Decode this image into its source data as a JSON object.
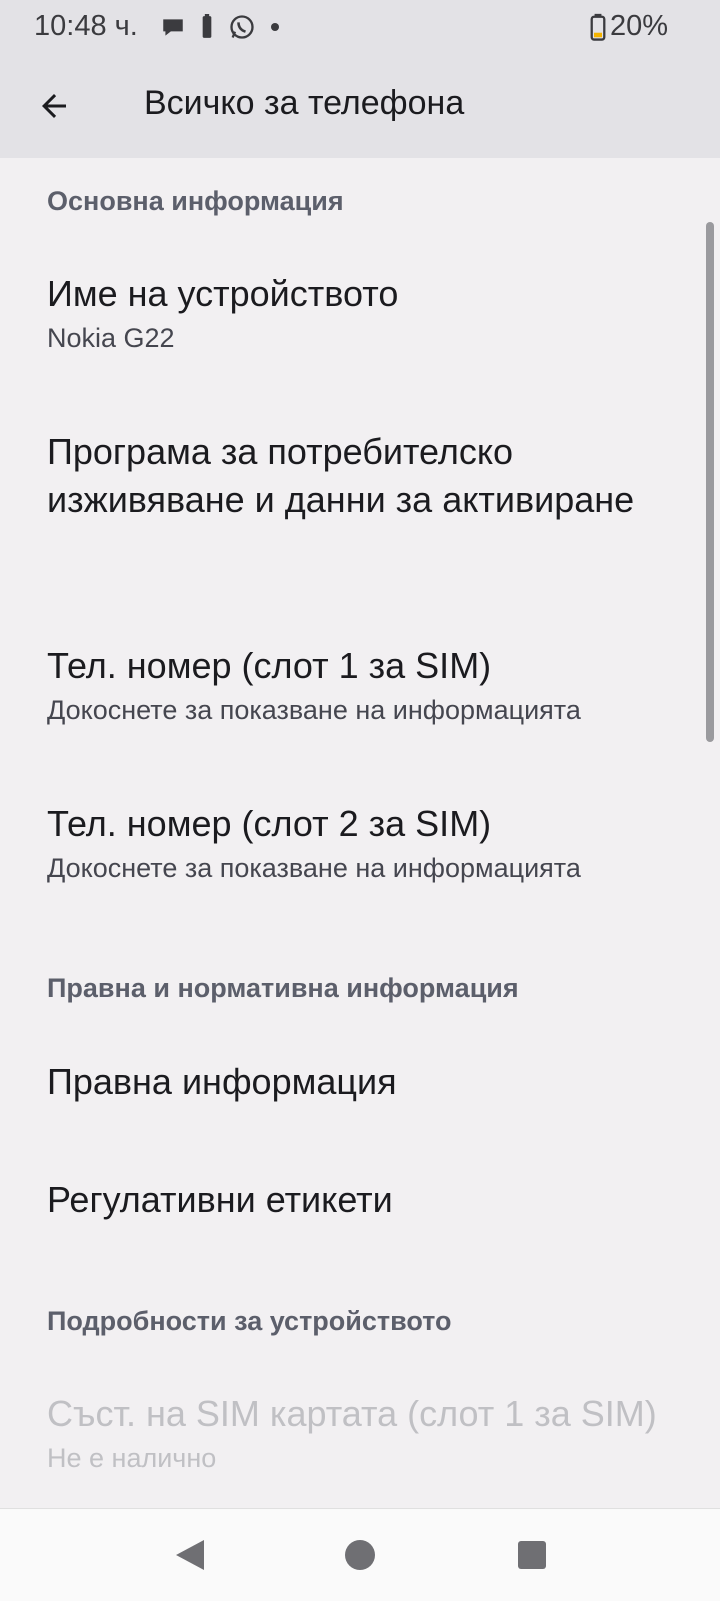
{
  "status_bar": {
    "time": "10:48 ч.",
    "battery_percent": "20%",
    "icons": [
      "chat-icon",
      "battery-small-icon",
      "whatsapp-icon",
      "dot-icon"
    ]
  },
  "app_bar": {
    "title": "Всичко за телефона",
    "back_icon": "arrow-back-icon"
  },
  "sections": [
    {
      "header": "Основна информация"
    },
    {
      "header": "Правна и нормативна информация"
    },
    {
      "header": "Подробности за устройството"
    }
  ],
  "items": [
    {
      "title": "Име на устройството",
      "summary": "Nokia G22"
    },
    {
      "title": "Програма за потребителско изживяване и данни за активиране",
      "summary": ""
    },
    {
      "title": "Тел. номер (слот 1 за SIM)",
      "summary": "Докоснете за показване на информацията"
    },
    {
      "title": "Тел. номер (слот 2 за SIM)",
      "summary": "Докоснете за показване на информацията"
    },
    {
      "title": "Правна информация",
      "summary": ""
    },
    {
      "title": "Регулативни етикети",
      "summary": ""
    },
    {
      "title": "Съст. на SIM картата (слот 1 за SIM)",
      "summary": "Не е налично"
    }
  ],
  "nav_bar": {
    "back": "nav-back-icon",
    "home": "nav-home-icon",
    "recents": "nav-recents-icon"
  },
  "colors": {
    "background": "#f2f0f2",
    "app_bar": "#e3e2e6",
    "section_header": "#5c5f6b",
    "battery_low": "#f5b400"
  }
}
